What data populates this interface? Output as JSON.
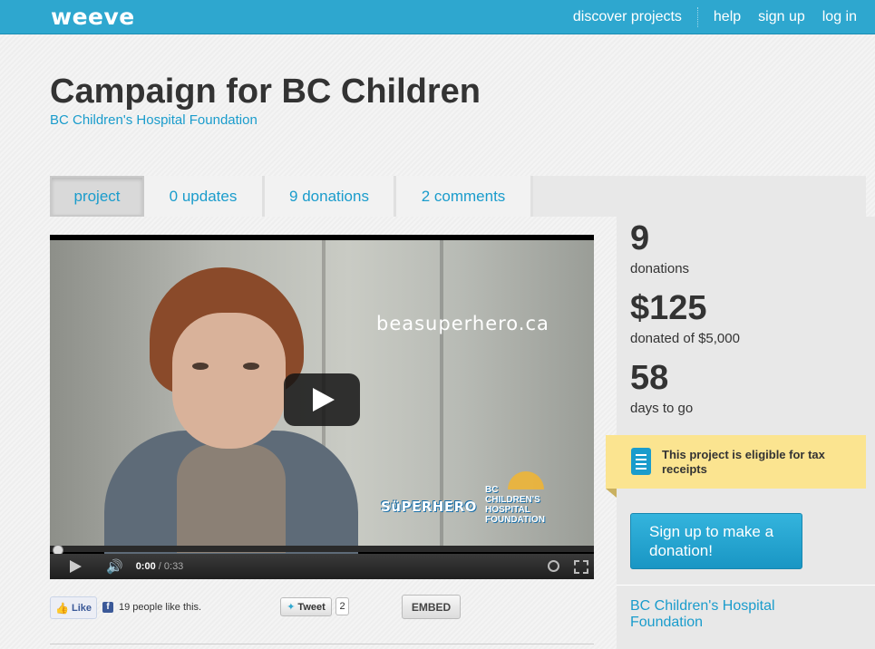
{
  "header": {
    "logo": "weeve",
    "nav": {
      "discover": "discover projects",
      "help": "help",
      "signup": "sign up",
      "login": "log in"
    }
  },
  "project": {
    "title": "Campaign for BC Children",
    "organization": "BC Children's Hospital Foundation"
  },
  "tabs": [
    {
      "label": "project",
      "active": true
    },
    {
      "label": "0 updates",
      "active": false
    },
    {
      "label": "9 donations",
      "active": false
    },
    {
      "label": "2 comments",
      "active": false
    }
  ],
  "video": {
    "overlay_url": "beasuperhero.ca",
    "superhero_logo": "SüPERHERO",
    "foundation_logo": "BC CHILDREN'S HOSPITAL FOUNDATION",
    "current_time": "0:00",
    "duration": "/ 0:33",
    "progress": 0
  },
  "social": {
    "like_label": "Like",
    "like_text": "19 people like this.",
    "tweet_label": "Tweet",
    "tweet_count": "2",
    "embed_label": "EMBED"
  },
  "stats": {
    "donations_count": "9",
    "donations_label": "donations",
    "amount": "$125",
    "amount_label": "donated of $5,000",
    "days": "58",
    "days_label": "days to go"
  },
  "tax_notice": "This project is eligible for tax receipts",
  "donate_button": "Sign up to make a donation!",
  "sidebar_org": "BC Children's Hospital Foundation",
  "colors": {
    "brand": "#2ea7cf",
    "link": "#1a9ccc",
    "notice": "#fbe490"
  }
}
